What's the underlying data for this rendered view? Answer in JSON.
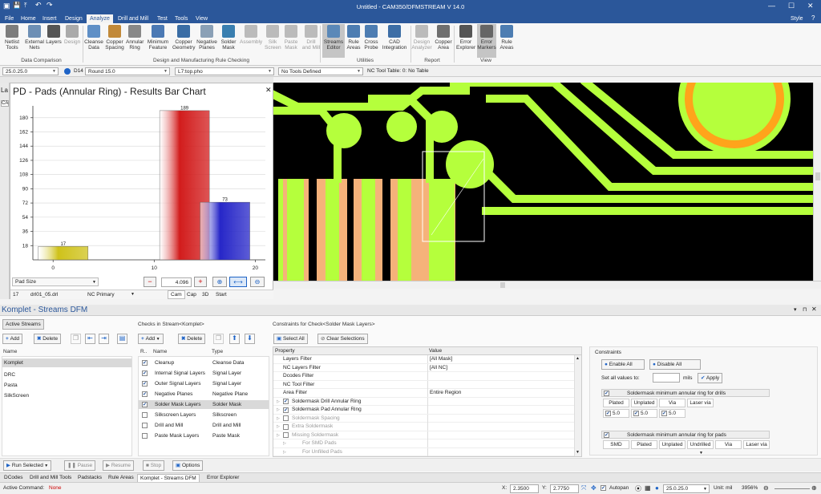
{
  "title": "Untitled - CAM350/DFMSTREAM V 14.0",
  "style_label": "Style",
  "menu": [
    "File",
    "Home",
    "Insert",
    "Design",
    "Analyze",
    "Drill and Mill",
    "Test",
    "Tools",
    "View"
  ],
  "ribbon": {
    "buttons": [
      {
        "label": "Netlist\nTools",
        "color": "#7d7d7d"
      },
      {
        "label": "External\nNets",
        "color": "#6d8fb5"
      },
      {
        "label": "Layers",
        "color": "#555"
      },
      {
        "label": "Design",
        "color": "#aaa",
        "gray": true
      },
      {
        "label": "Cleanse\nData",
        "color": "#5f8fc6"
      },
      {
        "label": "Copper\nSpacing",
        "color": "#c28a3a"
      },
      {
        "label": "Annular\nRing",
        "color": "#888"
      },
      {
        "label": "Minimum\nFeature",
        "color": "#4b79b4"
      },
      {
        "label": "Copper\nGeometry",
        "color": "#3a6da5"
      },
      {
        "label": "Negative\nPlanes",
        "color": "#8aa0b6"
      },
      {
        "label": "Solder\nMask",
        "color": "#3a7fb0"
      },
      {
        "label": "Assembly",
        "color": "#bbb",
        "gray": true
      },
      {
        "label": "Silk\nScreen",
        "color": "#bbb",
        "gray": true
      },
      {
        "label": "Paste\nMask",
        "color": "#bbb",
        "gray": true
      },
      {
        "label": "Drill\nand Mill",
        "color": "#bbb",
        "gray": true
      },
      {
        "label": "Streams\nEditor",
        "color": "#5a88b8",
        "sel": true
      },
      {
        "label": "Rule\nAreas",
        "color": "#4d7db2"
      },
      {
        "label": "Cross\nProbe",
        "color": "#4d7db2"
      },
      {
        "label": "CAD\nIntegration",
        "color": "#3d6ea6"
      },
      {
        "label": "Design\nAnalyzer",
        "color": "#bbb",
        "gray": true
      },
      {
        "label": "Copper\nArea",
        "color": "#6f6f6f"
      },
      {
        "label": "Error\nExplorer",
        "color": "#555"
      },
      {
        "label": "Error\nMarkers",
        "color": "#666",
        "sel": true
      },
      {
        "label": "Rule\nAreas",
        "color": "#4d7db2"
      }
    ],
    "groups": [
      "Data Comparison",
      "Design and Manufacturing Rule Checking",
      "Utilities",
      "Report",
      "View"
    ]
  },
  "toolbar": {
    "layer": "25.0.25.0",
    "dcode": "D14",
    "dcode_desc": "Round 15.0",
    "file": "L7:top.pho",
    "tools": "No Tools Defined",
    "nc_table": "NC Tool Table: 0: No Table"
  },
  "chart": {
    "title": "PD - Pads (Annular Ring) - Results Bar Chart",
    "side_label": "La",
    "side_tab": "CA",
    "pad_size_label": "Pad Size",
    "zoom": "4.096",
    "bottom_row": {
      "num": "17",
      "file": "drl01_05.drl",
      "nc": "NC Primary"
    },
    "view_tabs": [
      "Cam",
      "Cap",
      "3D",
      "Start"
    ]
  },
  "chart_data": {
    "type": "bar",
    "x_ticks": [
      0,
      10,
      20
    ],
    "y_ticks": [
      18,
      36,
      54,
      72,
      90,
      108,
      126,
      144,
      162,
      180
    ],
    "ylim": [
      0,
      195
    ],
    "xlim": [
      -2,
      21
    ],
    "bars": [
      {
        "x": 1,
        "value": 17,
        "label": "17",
        "color": "#cfc21a"
      },
      {
        "x": 13,
        "value": 189,
        "label": "189",
        "color": "#d21c1c"
      },
      {
        "x": 17,
        "value": 73,
        "label": "73",
        "color": "#2626c8"
      }
    ]
  },
  "streams": {
    "title": "Komplet - Streams DFM",
    "active_streams_label": "Active Streams",
    "add": "Add",
    "delete": "Delete",
    "name_header": "Name",
    "items": [
      "Komplet",
      "DRC",
      "Pasta",
      "SilkScreen"
    ]
  },
  "checks": {
    "header": "Checks in Stream<Komplet>",
    "add": "Add",
    "delete": "Delete",
    "col_r": "R..",
    "col_name": "Name",
    "col_type": "Type",
    "rows": [
      {
        "checked": true,
        "name": "Cleanup",
        "type": "Cleanse Data"
      },
      {
        "checked": true,
        "name": "Internal Signal Layers",
        "type": "Signal Layer"
      },
      {
        "checked": true,
        "name": "Outer Signal Layers",
        "type": "Signal Layer"
      },
      {
        "checked": true,
        "name": "Negative Planes",
        "type": "Negative Plane"
      },
      {
        "checked": true,
        "name": "Solder Mask Layers",
        "type": "Solder Mask",
        "selected": true
      },
      {
        "checked": false,
        "name": "Silkscreen Layers",
        "type": "Silkscreen"
      },
      {
        "checked": false,
        "name": "Drill and Mill",
        "type": "Drill and Mill"
      },
      {
        "checked": false,
        "name": "Paste Mask Layers",
        "type": "Paste Mask"
      }
    ]
  },
  "constraints_grid": {
    "header": "Constraints for Check<Solder Mask Layers>",
    "select_all": "Select All",
    "clear": "Clear Selections",
    "col_property": "Property",
    "col_value": "Value",
    "rows": [
      {
        "name": "Layers Filter",
        "value": "[All Mask]",
        "indent": 0
      },
      {
        "name": "NC Layers Filter",
        "value": "[All NC]",
        "indent": 0
      },
      {
        "name": "Dcodes Filter",
        "value": "",
        "indent": 0
      },
      {
        "name": "NC Tool Filter",
        "value": "",
        "indent": 0
      },
      {
        "name": "Area Filter",
        "value": "Entire Region",
        "indent": 0
      },
      {
        "name": "Soldermask Drill Annular Ring",
        "value": "",
        "indent": 1,
        "check": true
      },
      {
        "name": "Soldermask Pad Annular Ring",
        "value": "",
        "indent": 1,
        "check": true
      },
      {
        "name": "Soldermask Spacing",
        "value": "",
        "indent": 1,
        "gray": true
      },
      {
        "name": "Extra Soldermask",
        "value": "",
        "indent": 1,
        "gray": true
      },
      {
        "name": "Missing Soldermask",
        "value": "",
        "indent": 1,
        "gray": true
      },
      {
        "name": "For SMD Pads",
        "value": "",
        "indent": 2,
        "gray": true
      },
      {
        "name": "For Unfilled Pads",
        "value": "",
        "indent": 2,
        "gray": true
      }
    ]
  },
  "constraints_panel": {
    "title": "Constraints",
    "enable_all": "Enable All",
    "disable_all": "Disable All",
    "set_all_label": "Set all values to:",
    "units": "mils",
    "apply": "Apply",
    "drill_group": "Soldermask minimum annular ring for drills",
    "drill_cols": [
      "Plated",
      "Unplated",
      "Via",
      "Laser via"
    ],
    "drill_vals": [
      "5.0",
      "5.0",
      "5.0"
    ],
    "pad_group": "Soldermask minimum annular ring for pads",
    "pad_cols": [
      "SMD",
      "Plated",
      "Unplated",
      "Undrilled",
      "Via",
      "Laser via"
    ]
  },
  "run": {
    "run_selected": "Run Selected",
    "pause": "Pause",
    "resume": "Resume",
    "stop": "Stop",
    "options": "Options"
  },
  "bottom_tabs": [
    "DCodes",
    "Drill and Mill Tools",
    "Padstacks",
    "Rule Areas",
    "Komplet - Streams DFM",
    "Error Explorer"
  ],
  "status": {
    "active_command_label": "Active Command:",
    "active_command": "None",
    "x_label": "X:",
    "x": "2.3500",
    "y_label": "Y:",
    "y": "2.7750",
    "autopan": "Autopan",
    "layer": "25.0.25.0",
    "unit": "Unit: mil",
    "zoom": "3956%"
  },
  "colors": {
    "accent": "#2b579a",
    "pcb_green": "#b5ff3c",
    "pcb_pad": "#f5b27a"
  }
}
